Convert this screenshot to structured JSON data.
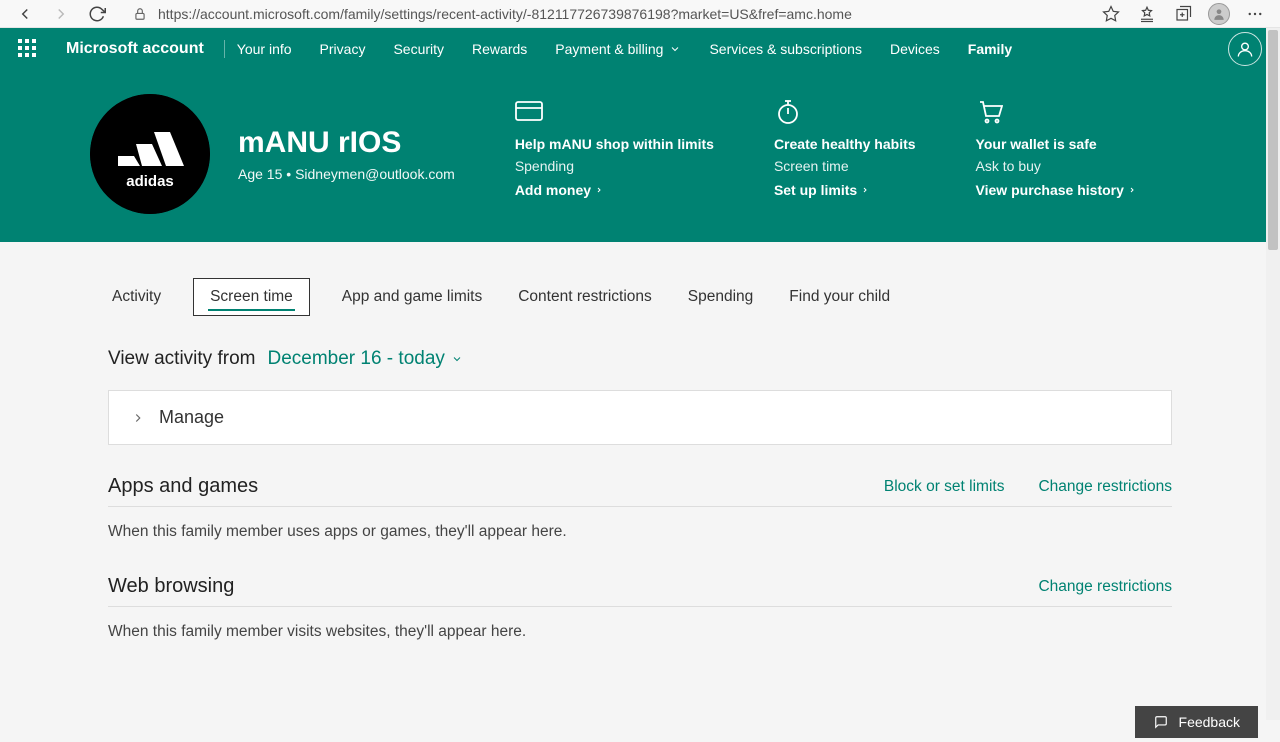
{
  "browser": {
    "url": "https://account.microsoft.com/family/settings/recent-activity/-812117726739876198?market=US&fref=amc.home"
  },
  "header": {
    "brand": "Microsoft account",
    "nav": {
      "your_info": "Your info",
      "privacy": "Privacy",
      "security": "Security",
      "rewards": "Rewards",
      "payment": "Payment & billing",
      "services": "Services & subscriptions",
      "devices": "Devices",
      "family": "Family"
    }
  },
  "profile": {
    "name": "mANU rIOS",
    "age_label": "Age 15",
    "sep": " • ",
    "email": "Sidneymen@outlook.com",
    "avatar_label": "adidas"
  },
  "hero_cards": {
    "spending": {
      "title": "Help mANU shop within limits",
      "sub": "Spending",
      "link": "Add money"
    },
    "screen": {
      "title": "Create healthy habits",
      "sub": "Screen time",
      "link": "Set up limits"
    },
    "wallet": {
      "title": "Your wallet is safe",
      "sub": "Ask to buy",
      "link": "View purchase history"
    }
  },
  "tabs": {
    "activity": "Activity",
    "screen_time": "Screen time",
    "app_limits": "App and game limits",
    "content": "Content restrictions",
    "spending": "Spending",
    "find": "Find your child"
  },
  "view_from": {
    "label": "View activity from",
    "value": "December 16 - today"
  },
  "manage": "Manage",
  "sections": {
    "apps": {
      "title": "Apps and games",
      "link1": "Block or set limits",
      "link2": "Change restrictions",
      "empty": "When this family member uses apps or games, they'll appear here."
    },
    "web": {
      "title": "Web browsing",
      "link2": "Change restrictions",
      "empty": "When this family member visits websites, they'll appear here."
    }
  },
  "feedback": "Feedback"
}
